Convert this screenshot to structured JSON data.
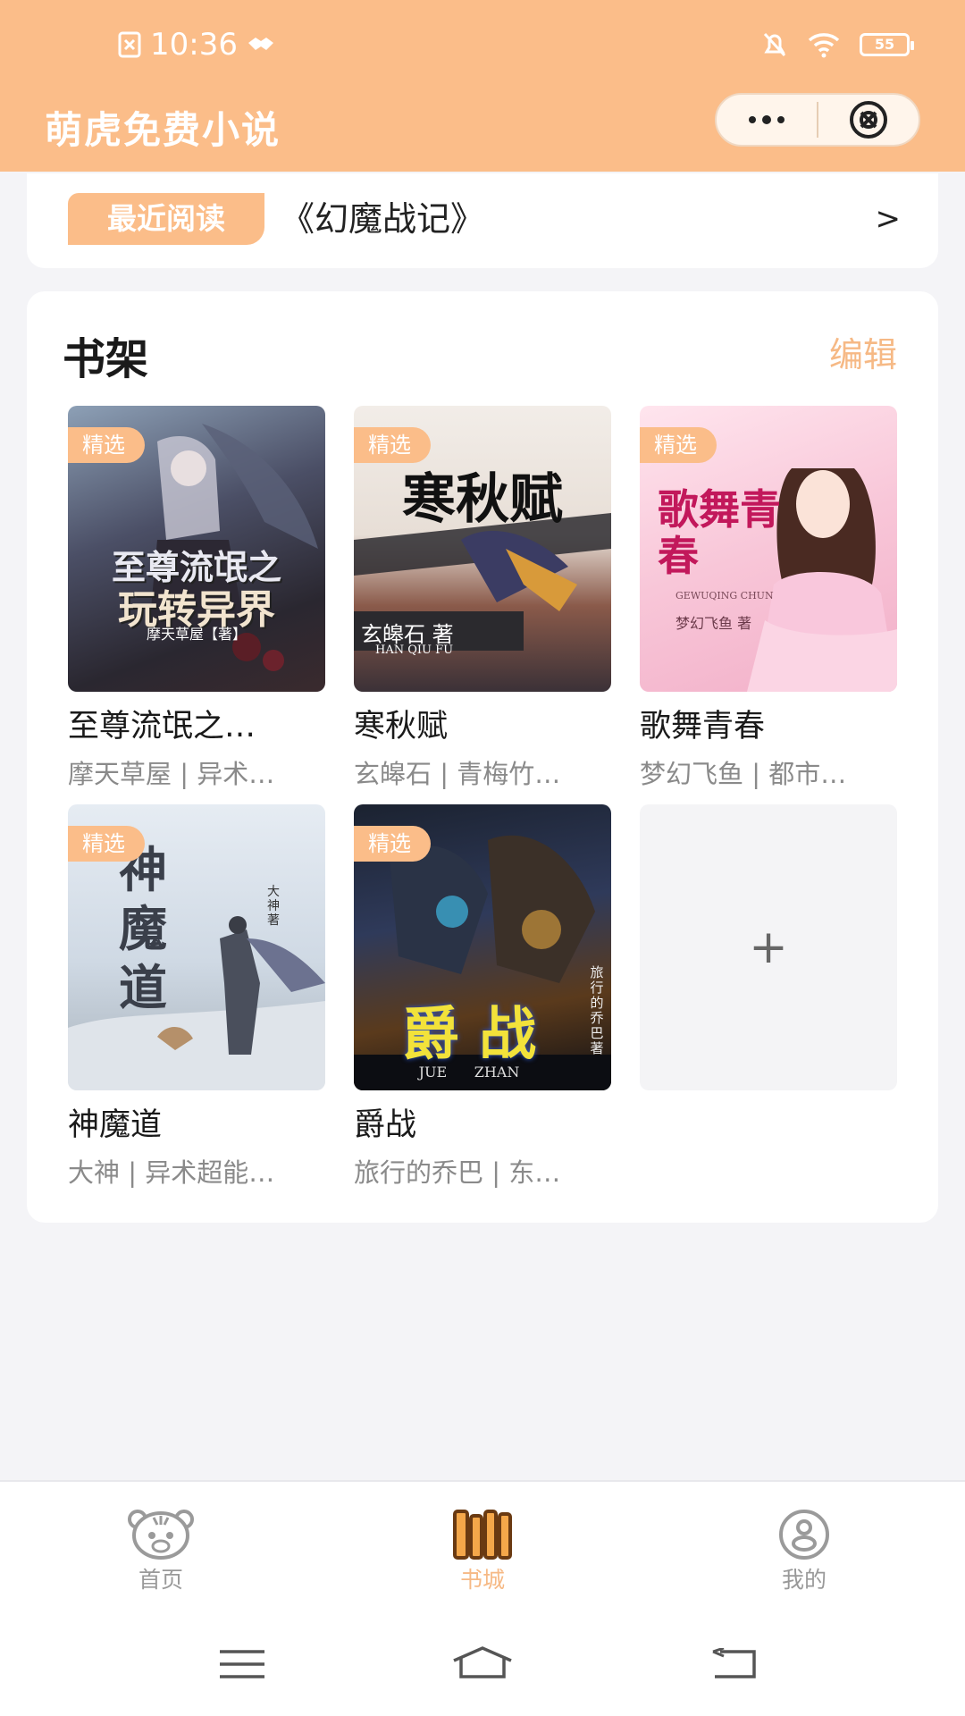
{
  "status_bar": {
    "time": "10:36",
    "battery": "55"
  },
  "app_bar": {
    "title": "萌虎免费小说",
    "more_icon": "more-dots-icon",
    "close_icon": "close-circle-icon"
  },
  "recent": {
    "badge": "最近阅读",
    "book_title": "《幻魔战记》",
    "arrow": ">"
  },
  "shelf": {
    "title": "书架",
    "edit_label": "编辑",
    "add_label": "+",
    "books": [
      {
        "badge": "精选",
        "title": "至尊流氓之…",
        "meta": "摩天草屋 | 异术…",
        "cover_text": "至尊流氓之",
        "cover_text2": "玩转异界",
        "cover_author": "摩天草屋【著】"
      },
      {
        "badge": "精选",
        "title": "寒秋赋",
        "meta": "玄皞石 | 青梅竹…",
        "cover_text": "寒秋赋",
        "cover_author": "玄皞石 著",
        "cover_pinyin": "HAN QIU FU"
      },
      {
        "badge": "精选",
        "title": "歌舞青春",
        "meta": "梦幻飞鱼 | 都市…",
        "cover_text": "歌舞青春",
        "cover_pinyin": "GEWUQING CHUN",
        "cover_author": "梦幻飞鱼 著"
      },
      {
        "badge": "精选",
        "title": "神魔道",
        "meta": "大神 | 异术超能…",
        "cover_text": "神魔道",
        "cover_author": "大神 著"
      },
      {
        "badge": "精选",
        "title": "爵战",
        "meta": "旅行的乔巴 | 东…",
        "cover_text": "爵 战",
        "cover_pinyin": "JUE      ZHAN",
        "cover_author": "旅行的乔巴著"
      }
    ]
  },
  "tabbar": {
    "items": [
      {
        "label": "首页",
        "icon": "tiger-face-icon"
      },
      {
        "label": "书城",
        "icon": "bookshelf-icon",
        "active": true
      },
      {
        "label": "我的",
        "icon": "user-profile-icon"
      }
    ]
  },
  "colors": {
    "accent": "#fbbd89",
    "accent_text": "#f6b985",
    "background": "#f4f4f7"
  }
}
